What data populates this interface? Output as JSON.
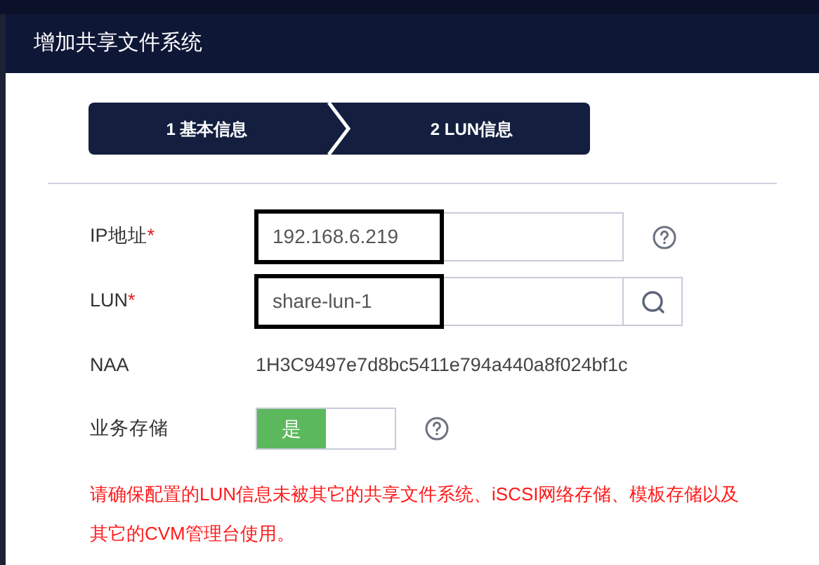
{
  "dialog": {
    "title": "增加共享文件系统"
  },
  "steps": [
    {
      "label": "1 基本信息"
    },
    {
      "label": "2 LUN信息"
    }
  ],
  "form": [
    {
      "kind": "input",
      "label": "IP地址",
      "required_mark": "*",
      "value": "192.168.6.219",
      "help": true
    },
    {
      "kind": "search",
      "label": "LUN",
      "required_mark": "*",
      "value": "share-lun-1"
    },
    {
      "kind": "text",
      "label": "NAA",
      "value": "1H3C9497e7d8bc5411e794a440a8f024bf1c"
    },
    {
      "kind": "toggle",
      "label": "业务存储",
      "on": true,
      "on_label": "是",
      "help": true
    }
  ],
  "warning": "请确保配置的LUN信息未被其它的共享文件系统、iSCSI网络存储、模板存储以及其它的CVM管理台使用。"
}
